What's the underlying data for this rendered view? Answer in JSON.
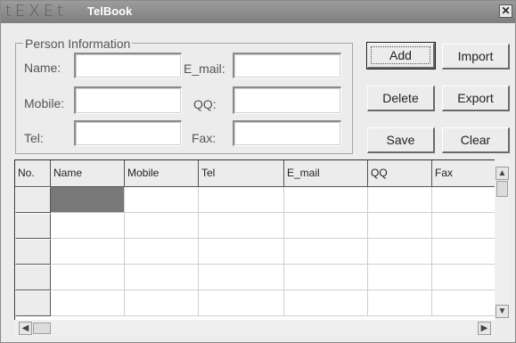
{
  "window": {
    "logo_text": "tEXEt",
    "title": "TelBook",
    "close_glyph": "✕"
  },
  "person_info": {
    "legend": "Person  Information",
    "fields": {
      "name": {
        "label": "Name:",
        "value": ""
      },
      "email": {
        "label": "E_mail:",
        "value": ""
      },
      "mobile": {
        "label": "Mobile:",
        "value": ""
      },
      "qq": {
        "label": "QQ:",
        "value": ""
      },
      "tel": {
        "label": "Tel:",
        "value": ""
      },
      "fax": {
        "label": "Fax:",
        "value": ""
      }
    }
  },
  "buttons": {
    "add": "Add",
    "import": "Import",
    "delete": "Delete",
    "export": "Export",
    "save": "Save",
    "clear": "Clear"
  },
  "grid": {
    "columns": [
      "No.",
      "Name",
      "Mobile",
      "Tel",
      "E_mail",
      "QQ",
      "Fax"
    ],
    "visible_rows": 5,
    "selected_cell": {
      "row": 0,
      "column": "Name"
    }
  },
  "scrollbars": {
    "up": "▲",
    "down": "▼",
    "left": "◀",
    "right": "▶"
  },
  "colors": {
    "titlebar": "#8c8c8c",
    "window_bg": "#ececec",
    "selected_cell": "#787878"
  },
  "icons": [
    "close-icon",
    "scroll-up-icon",
    "scroll-down-icon",
    "scroll-left-icon",
    "scroll-right-icon"
  ]
}
